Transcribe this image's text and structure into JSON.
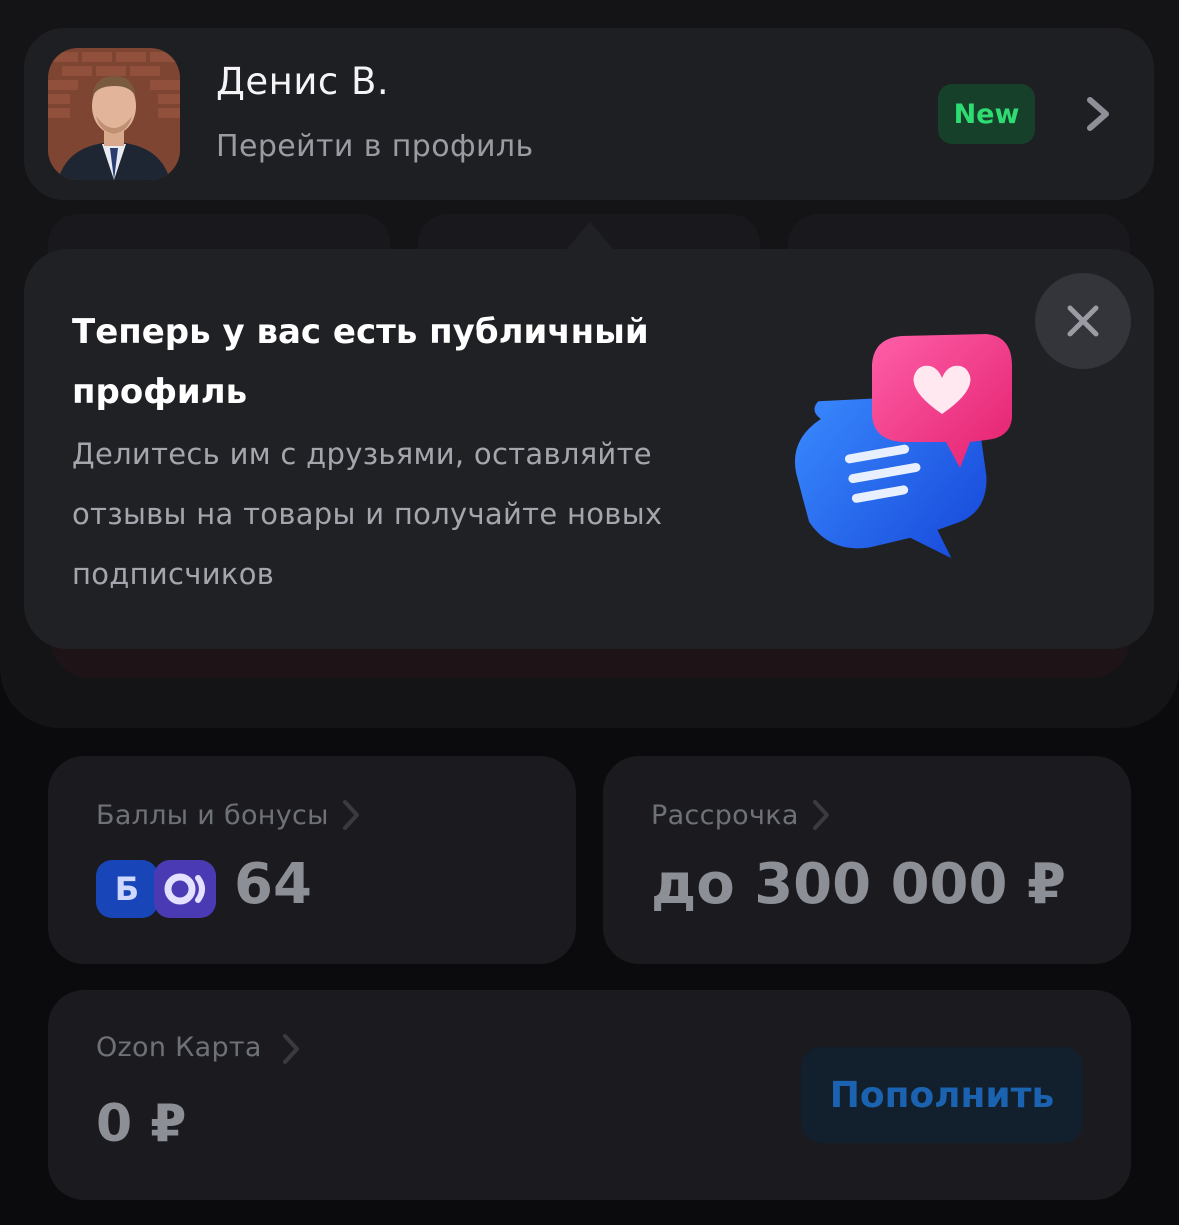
{
  "profile": {
    "name": "Денис В.",
    "link_label": "Перейти в профиль",
    "badge": "New",
    "icons": {
      "avatar": "user-photo",
      "chevron": "chevron-right-icon"
    }
  },
  "popover": {
    "title": "Теперь у вас есть публичный профиль",
    "body": "Делитесь им с друзьями, оставляйте отзывы на товары и получайте новых подписчиков",
    "close_icon": "close-icon",
    "illustration": "chat-bubbles-heart-illustration"
  },
  "bonus_card": {
    "label": "Баллы и бонусы",
    "value": "64",
    "badge_b": "Б"
  },
  "installment_card": {
    "label": "Рассрочка",
    "value": "до 300 000 ₽"
  },
  "ozon_card": {
    "label": "Ozon Карта",
    "value": "0 ₽",
    "button": "Пополнить"
  },
  "colors": {
    "accent_green": "#2fdc72",
    "accent_blue": "#1b62b0",
    "background": "#0b0b0d",
    "card": "#1b1b1f"
  }
}
